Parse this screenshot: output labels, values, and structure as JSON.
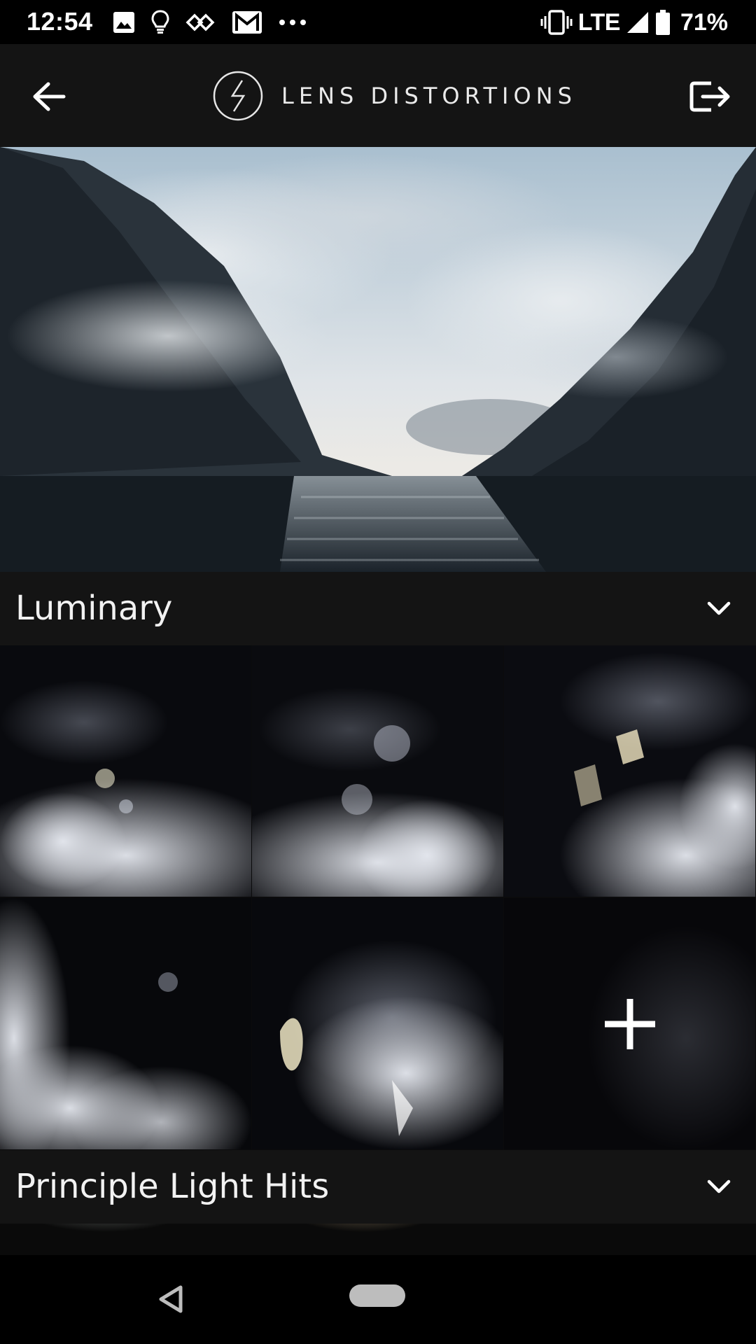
{
  "status_bar": {
    "time": "12:54",
    "left_icons": [
      "image-icon",
      "lightbulb-icon",
      "link-icon",
      "gmail-icon",
      "more-dots-icon"
    ],
    "network": "LTE",
    "battery_percent": "71%"
  },
  "app_bar": {
    "title": "LENS DISTORTIONS",
    "back_icon": "arrow-left-icon",
    "export_icon": "export-icon"
  },
  "sections": [
    {
      "title": "Luminary",
      "expanded": true
    },
    {
      "title": "Principle Light Hits",
      "expanded": true
    }
  ],
  "luminary_tiles": [
    {
      "label": "",
      "kind": "preview"
    },
    {
      "label": "",
      "kind": "preview"
    },
    {
      "label": "",
      "kind": "preview"
    },
    {
      "label": "",
      "kind": "preview"
    },
    {
      "label": "",
      "kind": "preview"
    },
    {
      "label": "",
      "kind": "add"
    }
  ],
  "colors": {
    "bar": "#141414",
    "background": "#0b0b0c",
    "text": "#f2f2f2"
  }
}
